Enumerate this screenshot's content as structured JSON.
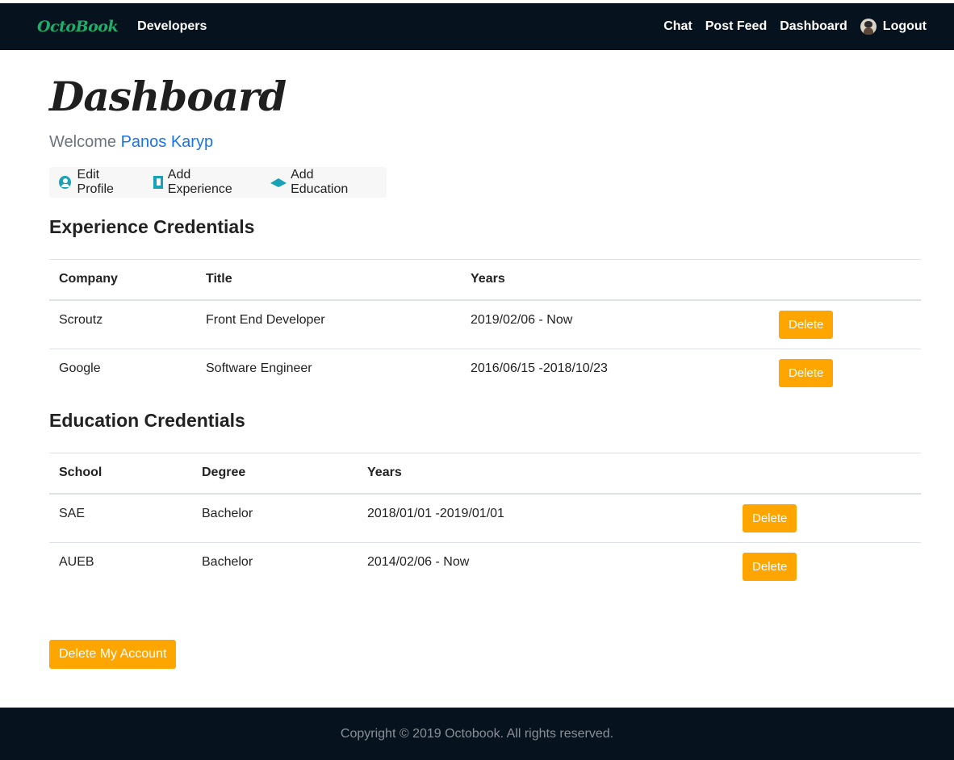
{
  "navbar": {
    "brand": "OctoBook",
    "developers": "Developers",
    "chat": "Chat",
    "post_feed": "Post Feed",
    "dashboard": "Dashboard",
    "logout": "Logout"
  },
  "page": {
    "title": "Dashboard",
    "welcome_prefix": "Welcome",
    "user_name": "Panos Karyp"
  },
  "actions": {
    "edit_profile": "Edit Profile",
    "add_experience": "Add Experience",
    "add_education": "Add Education"
  },
  "experience": {
    "title": "Experience Credentials",
    "headers": [
      "Company",
      "Title",
      "Years"
    ],
    "rows": [
      {
        "company": "Scroutz",
        "title": "Front End Developer",
        "years": "2019/02/06 - Now",
        "action": "Delete"
      },
      {
        "company": "Google",
        "title": "Software Engineer",
        "years": "2016/06/15 -2018/10/23",
        "action": "Delete"
      }
    ]
  },
  "education": {
    "title": "Education Credentials",
    "headers": [
      "School",
      "Degree",
      "Years"
    ],
    "rows": [
      {
        "school": "SAE",
        "degree": "Bachelor",
        "years": "2018/01/01 -2019/01/01",
        "action": "Delete"
      },
      {
        "school": "AUEB",
        "degree": "Bachelor",
        "years": "2014/02/06 - Now",
        "action": "Delete"
      }
    ]
  },
  "delete_account": "Delete My Account",
  "footer": {
    "text": "Copyright © 2019 Octobook. All rights reserved."
  },
  "colors": {
    "navbar_bg": "#07121f",
    "brand": "#1fae6a",
    "accent_orange": "#ffa500",
    "link_blue": "#1a73e8",
    "icon_teal": "#17a2b8"
  }
}
